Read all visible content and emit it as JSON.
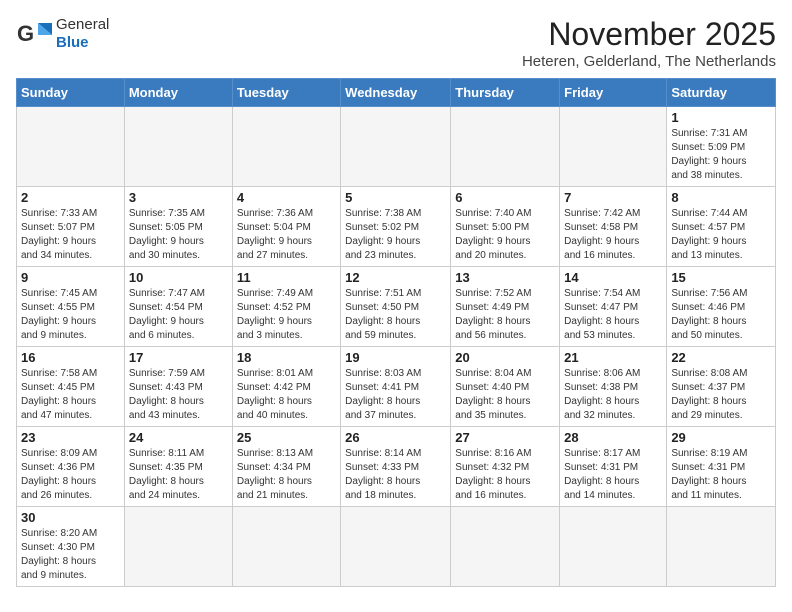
{
  "header": {
    "logo_line1": "General",
    "logo_line2": "Blue",
    "month": "November 2025",
    "location": "Heteren, Gelderland, The Netherlands"
  },
  "days_of_week": [
    "Sunday",
    "Monday",
    "Tuesday",
    "Wednesday",
    "Thursday",
    "Friday",
    "Saturday"
  ],
  "weeks": [
    [
      {
        "day": "",
        "info": ""
      },
      {
        "day": "",
        "info": ""
      },
      {
        "day": "",
        "info": ""
      },
      {
        "day": "",
        "info": ""
      },
      {
        "day": "",
        "info": ""
      },
      {
        "day": "",
        "info": ""
      },
      {
        "day": "1",
        "info": "Sunrise: 7:31 AM\nSunset: 5:09 PM\nDaylight: 9 hours\nand 38 minutes."
      }
    ],
    [
      {
        "day": "2",
        "info": "Sunrise: 7:33 AM\nSunset: 5:07 PM\nDaylight: 9 hours\nand 34 minutes."
      },
      {
        "day": "3",
        "info": "Sunrise: 7:35 AM\nSunset: 5:05 PM\nDaylight: 9 hours\nand 30 minutes."
      },
      {
        "day": "4",
        "info": "Sunrise: 7:36 AM\nSunset: 5:04 PM\nDaylight: 9 hours\nand 27 minutes."
      },
      {
        "day": "5",
        "info": "Sunrise: 7:38 AM\nSunset: 5:02 PM\nDaylight: 9 hours\nand 23 minutes."
      },
      {
        "day": "6",
        "info": "Sunrise: 7:40 AM\nSunset: 5:00 PM\nDaylight: 9 hours\nand 20 minutes."
      },
      {
        "day": "7",
        "info": "Sunrise: 7:42 AM\nSunset: 4:58 PM\nDaylight: 9 hours\nand 16 minutes."
      },
      {
        "day": "8",
        "info": "Sunrise: 7:44 AM\nSunset: 4:57 PM\nDaylight: 9 hours\nand 13 minutes."
      }
    ],
    [
      {
        "day": "9",
        "info": "Sunrise: 7:45 AM\nSunset: 4:55 PM\nDaylight: 9 hours\nand 9 minutes."
      },
      {
        "day": "10",
        "info": "Sunrise: 7:47 AM\nSunset: 4:54 PM\nDaylight: 9 hours\nand 6 minutes."
      },
      {
        "day": "11",
        "info": "Sunrise: 7:49 AM\nSunset: 4:52 PM\nDaylight: 9 hours\nand 3 minutes."
      },
      {
        "day": "12",
        "info": "Sunrise: 7:51 AM\nSunset: 4:50 PM\nDaylight: 8 hours\nand 59 minutes."
      },
      {
        "day": "13",
        "info": "Sunrise: 7:52 AM\nSunset: 4:49 PM\nDaylight: 8 hours\nand 56 minutes."
      },
      {
        "day": "14",
        "info": "Sunrise: 7:54 AM\nSunset: 4:47 PM\nDaylight: 8 hours\nand 53 minutes."
      },
      {
        "day": "15",
        "info": "Sunrise: 7:56 AM\nSunset: 4:46 PM\nDaylight: 8 hours\nand 50 minutes."
      }
    ],
    [
      {
        "day": "16",
        "info": "Sunrise: 7:58 AM\nSunset: 4:45 PM\nDaylight: 8 hours\nand 47 minutes."
      },
      {
        "day": "17",
        "info": "Sunrise: 7:59 AM\nSunset: 4:43 PM\nDaylight: 8 hours\nand 43 minutes."
      },
      {
        "day": "18",
        "info": "Sunrise: 8:01 AM\nSunset: 4:42 PM\nDaylight: 8 hours\nand 40 minutes."
      },
      {
        "day": "19",
        "info": "Sunrise: 8:03 AM\nSunset: 4:41 PM\nDaylight: 8 hours\nand 37 minutes."
      },
      {
        "day": "20",
        "info": "Sunrise: 8:04 AM\nSunset: 4:40 PM\nDaylight: 8 hours\nand 35 minutes."
      },
      {
        "day": "21",
        "info": "Sunrise: 8:06 AM\nSunset: 4:38 PM\nDaylight: 8 hours\nand 32 minutes."
      },
      {
        "day": "22",
        "info": "Sunrise: 8:08 AM\nSunset: 4:37 PM\nDaylight: 8 hours\nand 29 minutes."
      }
    ],
    [
      {
        "day": "23",
        "info": "Sunrise: 8:09 AM\nSunset: 4:36 PM\nDaylight: 8 hours\nand 26 minutes."
      },
      {
        "day": "24",
        "info": "Sunrise: 8:11 AM\nSunset: 4:35 PM\nDaylight: 8 hours\nand 24 minutes."
      },
      {
        "day": "25",
        "info": "Sunrise: 8:13 AM\nSunset: 4:34 PM\nDaylight: 8 hours\nand 21 minutes."
      },
      {
        "day": "26",
        "info": "Sunrise: 8:14 AM\nSunset: 4:33 PM\nDaylight: 8 hours\nand 18 minutes."
      },
      {
        "day": "27",
        "info": "Sunrise: 8:16 AM\nSunset: 4:32 PM\nDaylight: 8 hours\nand 16 minutes."
      },
      {
        "day": "28",
        "info": "Sunrise: 8:17 AM\nSunset: 4:31 PM\nDaylight: 8 hours\nand 14 minutes."
      },
      {
        "day": "29",
        "info": "Sunrise: 8:19 AM\nSunset: 4:31 PM\nDaylight: 8 hours\nand 11 minutes."
      }
    ],
    [
      {
        "day": "30",
        "info": "Sunrise: 8:20 AM\nSunset: 4:30 PM\nDaylight: 8 hours\nand 9 minutes."
      },
      {
        "day": "",
        "info": ""
      },
      {
        "day": "",
        "info": ""
      },
      {
        "day": "",
        "info": ""
      },
      {
        "day": "",
        "info": ""
      },
      {
        "day": "",
        "info": ""
      },
      {
        "day": "",
        "info": ""
      }
    ]
  ]
}
